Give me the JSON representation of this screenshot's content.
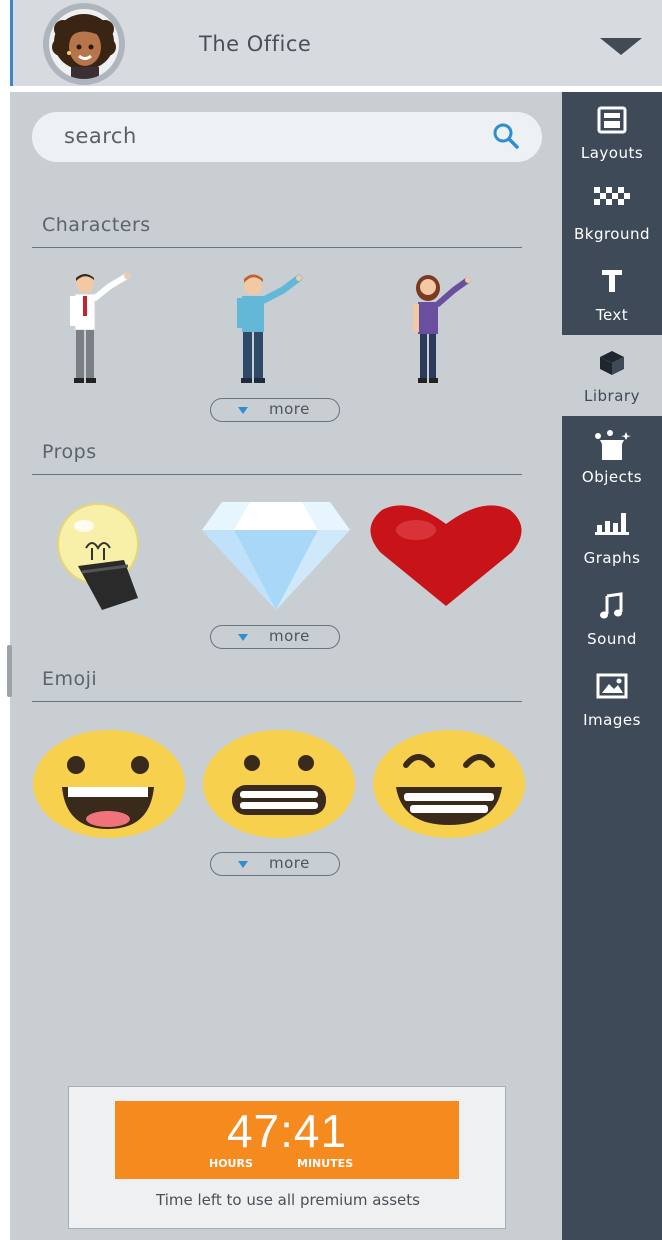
{
  "header": {
    "title": "The Office"
  },
  "search": {
    "placeholder": "search"
  },
  "sections": [
    {
      "label": "Characters",
      "more_label": "more"
    },
    {
      "label": "Props",
      "more_label": "more"
    },
    {
      "label": "Emoji",
      "more_label": "more"
    }
  ],
  "timer": {
    "time": "47:41",
    "hours_label": "HOURS",
    "minutes_label": "MINUTES",
    "caption": "Time left to use all premium assets"
  },
  "tabs": [
    {
      "label": "Layouts",
      "icon": "layouts-icon"
    },
    {
      "label": "Bkground",
      "icon": "background-icon"
    },
    {
      "label": "Text",
      "icon": "text-icon"
    },
    {
      "label": "Library",
      "icon": "library-icon",
      "active": true
    },
    {
      "label": "Objects",
      "icon": "objects-icon"
    },
    {
      "label": "Graphs",
      "icon": "graphs-icon"
    },
    {
      "label": "Sound",
      "icon": "sound-icon"
    },
    {
      "label": "Images",
      "icon": "images-icon"
    }
  ],
  "colors": {
    "sidebar": "#3f4a59",
    "panel": "#c9ced3",
    "accent": "#3e87c6",
    "timer": "#f58a1f"
  }
}
